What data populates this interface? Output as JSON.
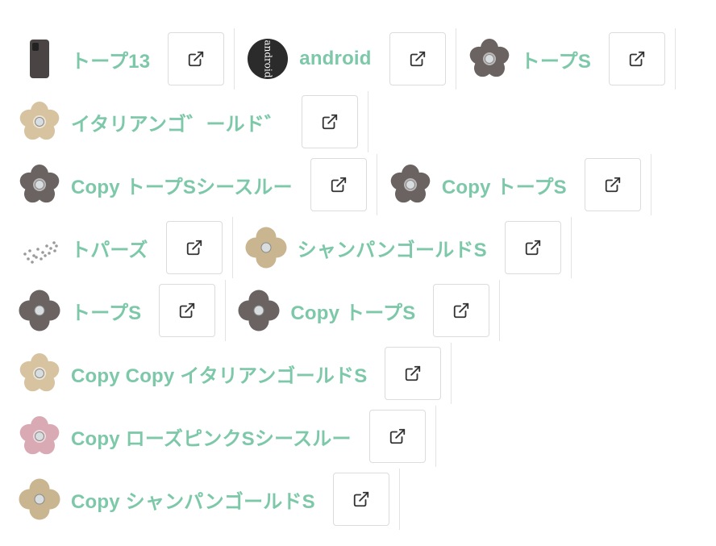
{
  "rows": [
    [
      {
        "label": "トープ13",
        "thumb": "phone-case-icon",
        "color": "#4a4444"
      },
      {
        "label": "android",
        "thumb": "android-avatar-icon",
        "color": "#2b2b2b",
        "thumb_text": "android"
      },
      {
        "label": "トープS",
        "thumb": "flower-icon",
        "color": "#6b6262"
      }
    ],
    [
      {
        "label": "イタリアンゴ゛ールド゛",
        "thumb": "flower-icon",
        "color": "#d8c3a0"
      }
    ],
    [
      {
        "label": "Copy トープSシースルー",
        "thumb": "flower-icon",
        "color": "#6b6262"
      },
      {
        "label": "Copy トープS",
        "thumb": "flower-icon",
        "color": "#6b6262"
      }
    ],
    [
      {
        "label": "トパーズ",
        "thumb": "rhinestone-scatter-icon",
        "color": "#9a9a9a"
      },
      {
        "label": "シャンパンゴールドS",
        "thumb": "clover-icon",
        "color": "#c9b58f"
      }
    ],
    [
      {
        "label": "トープS",
        "thumb": "clover-icon",
        "color": "#6b6262"
      },
      {
        "label": "Copy トープS",
        "thumb": "clover-icon",
        "color": "#6b6262"
      }
    ],
    [
      {
        "label": "Copy Copy イタリアンゴールドS",
        "thumb": "flower-icon",
        "color": "#d8c3a0"
      }
    ],
    [
      {
        "label": "Copy ローズピンクSシースルー",
        "thumb": "flower-icon",
        "color": "#d9a9b4"
      }
    ],
    [
      {
        "label": "Copy シャンパンゴールドS",
        "thumb": "clover-icon",
        "color": "#c9b58f"
      }
    ]
  ],
  "external_link_icon": "external-link-icon",
  "accent_color": "#7cc8a9"
}
